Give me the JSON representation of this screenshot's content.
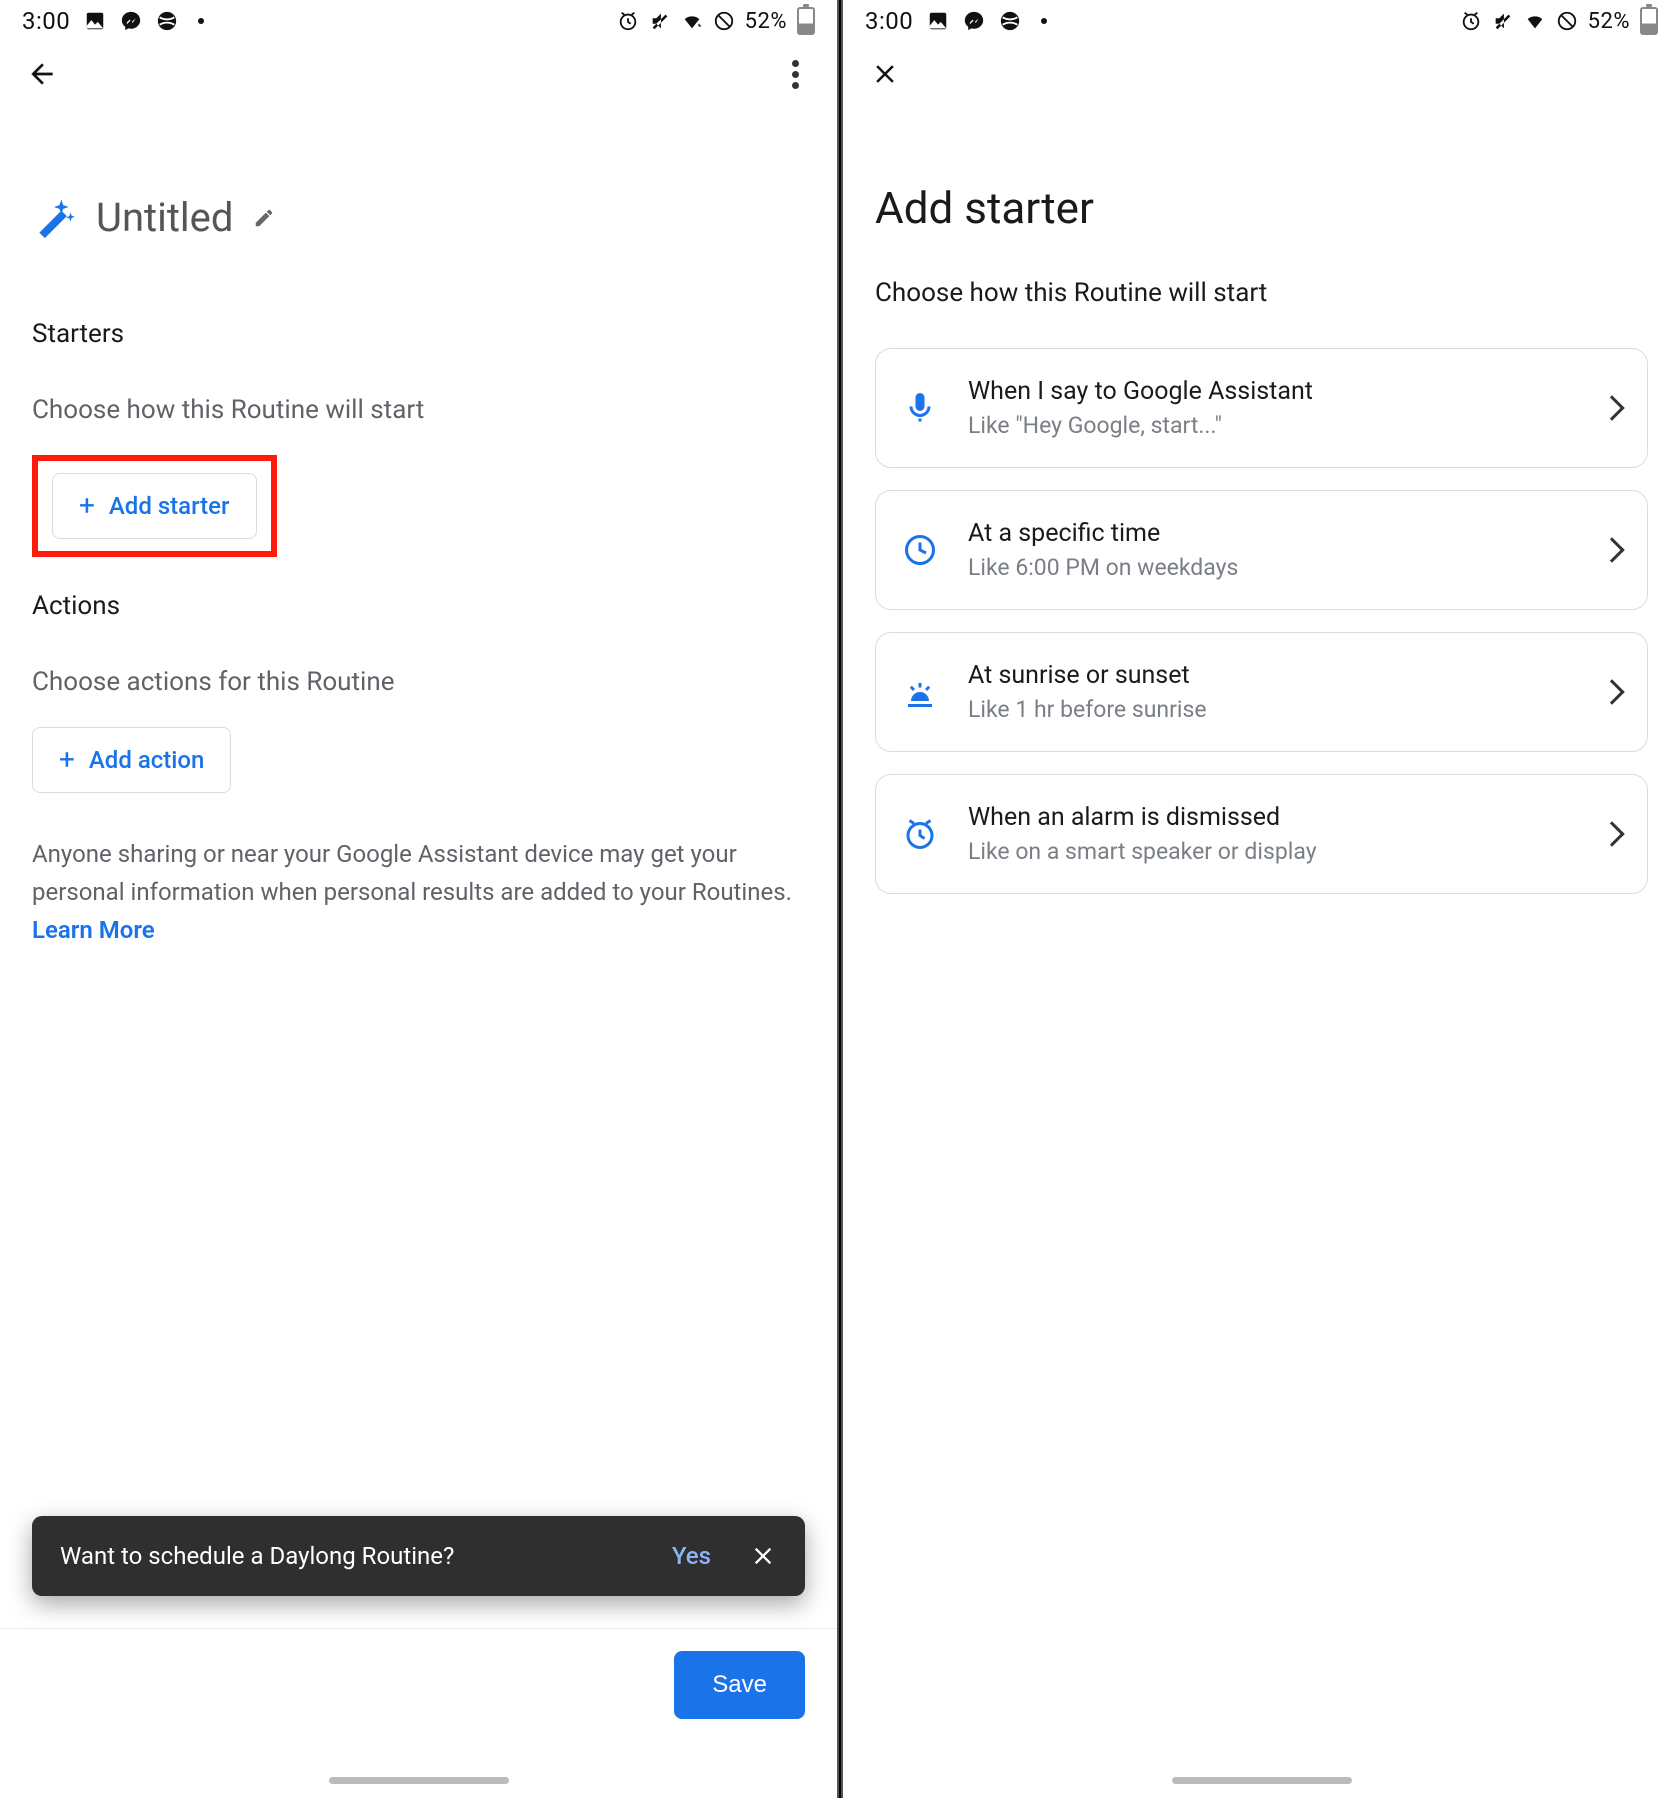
{
  "statusbar": {
    "time": "3:00",
    "battery": "52%"
  },
  "left": {
    "title": "Untitled",
    "starters_heading": "Starters",
    "starters_sub": "Choose how this Routine will start",
    "add_starter_label": "Add starter",
    "actions_heading": "Actions",
    "actions_sub": "Choose actions for this Routine",
    "add_action_label": "Add action",
    "info_text": "Anyone sharing or near your Google Assistant device may get your personal information when personal results are added to your Routines. ",
    "learn_more": "Learn More",
    "snackbar_text": "Want to schedule a Daylong Routine?",
    "snackbar_yes": "Yes",
    "save_label": "Save"
  },
  "right": {
    "title": "Add starter",
    "subtitle": "Choose how this Routine will start",
    "options": [
      {
        "title": "When I say to Google Assistant",
        "sub": "Like \"Hey Google, start...\""
      },
      {
        "title": "At a specific time",
        "sub": "Like 6:00 PM on weekdays"
      },
      {
        "title": "At sunrise or sunset",
        "sub": "Like 1 hr before sunrise"
      },
      {
        "title": "When an alarm is dismissed",
        "sub": "Like on a smart speaker or display"
      }
    ]
  }
}
